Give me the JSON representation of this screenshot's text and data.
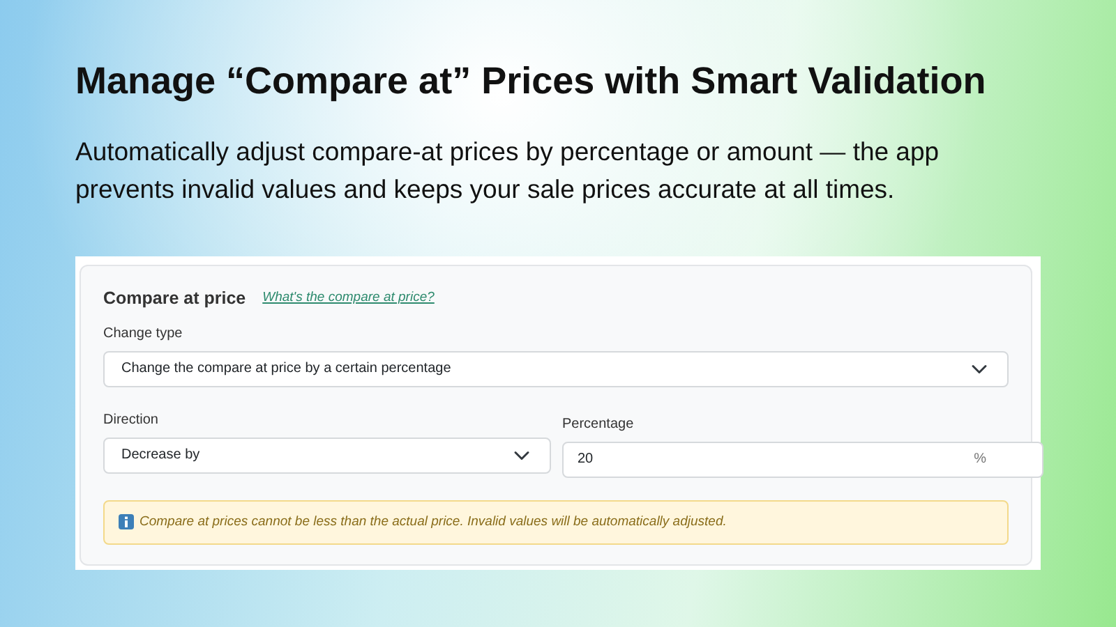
{
  "headline": "Manage “Compare at” Prices with Smart Validation",
  "description": "Automatically adjust compare-at prices by percentage or amount — the app prevents invalid values and keeps your sale prices accurate at all times.",
  "panel": {
    "title": "Compare at price",
    "help_link": "What's the compare at price?",
    "change_type": {
      "label": "Change type",
      "value": "Change the compare at price by a certain percentage"
    },
    "direction": {
      "label": "Direction",
      "value": "Decrease by"
    },
    "percentage": {
      "label": "Percentage",
      "value": "20",
      "suffix": "%"
    },
    "notice": "Compare at prices cannot be less than the actual price. Invalid values will be automatically adjusted."
  }
}
